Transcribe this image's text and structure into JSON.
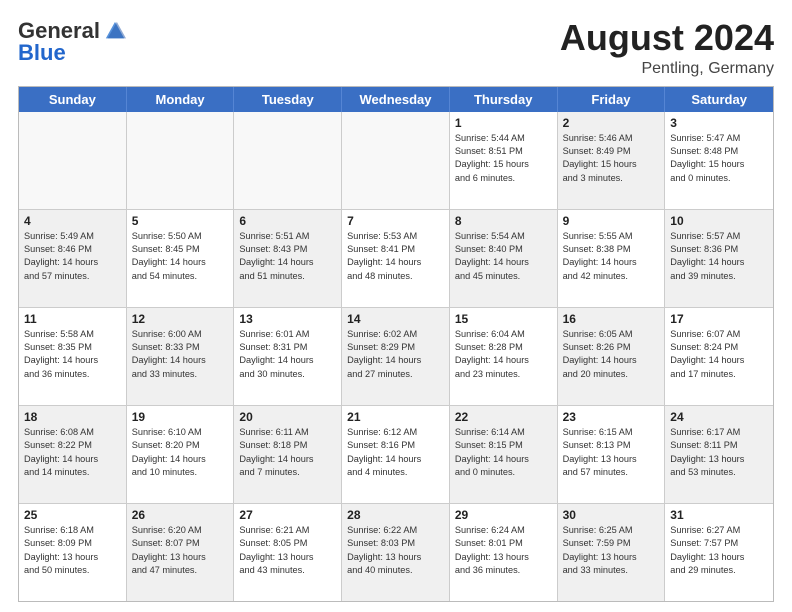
{
  "header": {
    "logo_general": "General",
    "logo_blue": "Blue",
    "month_title": "August 2024",
    "location": "Pentling, Germany"
  },
  "days_of_week": [
    "Sunday",
    "Monday",
    "Tuesday",
    "Wednesday",
    "Thursday",
    "Friday",
    "Saturday"
  ],
  "rows": [
    [
      {
        "day": "",
        "text": "",
        "empty": true
      },
      {
        "day": "",
        "text": "",
        "empty": true
      },
      {
        "day": "",
        "text": "",
        "empty": true
      },
      {
        "day": "",
        "text": "",
        "empty": true
      },
      {
        "day": "1",
        "text": "Sunrise: 5:44 AM\nSunset: 8:51 PM\nDaylight: 15 hours\nand 6 minutes."
      },
      {
        "day": "2",
        "text": "Sunrise: 5:46 AM\nSunset: 8:49 PM\nDaylight: 15 hours\nand 3 minutes.",
        "shaded": true
      },
      {
        "day": "3",
        "text": "Sunrise: 5:47 AM\nSunset: 8:48 PM\nDaylight: 15 hours\nand 0 minutes."
      }
    ],
    [
      {
        "day": "4",
        "text": "Sunrise: 5:49 AM\nSunset: 8:46 PM\nDaylight: 14 hours\nand 57 minutes.",
        "shaded": true
      },
      {
        "day": "5",
        "text": "Sunrise: 5:50 AM\nSunset: 8:45 PM\nDaylight: 14 hours\nand 54 minutes."
      },
      {
        "day": "6",
        "text": "Sunrise: 5:51 AM\nSunset: 8:43 PM\nDaylight: 14 hours\nand 51 minutes.",
        "shaded": true
      },
      {
        "day": "7",
        "text": "Sunrise: 5:53 AM\nSunset: 8:41 PM\nDaylight: 14 hours\nand 48 minutes."
      },
      {
        "day": "8",
        "text": "Sunrise: 5:54 AM\nSunset: 8:40 PM\nDaylight: 14 hours\nand 45 minutes.",
        "shaded": true
      },
      {
        "day": "9",
        "text": "Sunrise: 5:55 AM\nSunset: 8:38 PM\nDaylight: 14 hours\nand 42 minutes."
      },
      {
        "day": "10",
        "text": "Sunrise: 5:57 AM\nSunset: 8:36 PM\nDaylight: 14 hours\nand 39 minutes.",
        "shaded": true
      }
    ],
    [
      {
        "day": "11",
        "text": "Sunrise: 5:58 AM\nSunset: 8:35 PM\nDaylight: 14 hours\nand 36 minutes."
      },
      {
        "day": "12",
        "text": "Sunrise: 6:00 AM\nSunset: 8:33 PM\nDaylight: 14 hours\nand 33 minutes.",
        "shaded": true
      },
      {
        "day": "13",
        "text": "Sunrise: 6:01 AM\nSunset: 8:31 PM\nDaylight: 14 hours\nand 30 minutes."
      },
      {
        "day": "14",
        "text": "Sunrise: 6:02 AM\nSunset: 8:29 PM\nDaylight: 14 hours\nand 27 minutes.",
        "shaded": true
      },
      {
        "day": "15",
        "text": "Sunrise: 6:04 AM\nSunset: 8:28 PM\nDaylight: 14 hours\nand 23 minutes."
      },
      {
        "day": "16",
        "text": "Sunrise: 6:05 AM\nSunset: 8:26 PM\nDaylight: 14 hours\nand 20 minutes.",
        "shaded": true
      },
      {
        "day": "17",
        "text": "Sunrise: 6:07 AM\nSunset: 8:24 PM\nDaylight: 14 hours\nand 17 minutes."
      }
    ],
    [
      {
        "day": "18",
        "text": "Sunrise: 6:08 AM\nSunset: 8:22 PM\nDaylight: 14 hours\nand 14 minutes.",
        "shaded": true
      },
      {
        "day": "19",
        "text": "Sunrise: 6:10 AM\nSunset: 8:20 PM\nDaylight: 14 hours\nand 10 minutes."
      },
      {
        "day": "20",
        "text": "Sunrise: 6:11 AM\nSunset: 8:18 PM\nDaylight: 14 hours\nand 7 minutes.",
        "shaded": true
      },
      {
        "day": "21",
        "text": "Sunrise: 6:12 AM\nSunset: 8:16 PM\nDaylight: 14 hours\nand 4 minutes."
      },
      {
        "day": "22",
        "text": "Sunrise: 6:14 AM\nSunset: 8:15 PM\nDaylight: 14 hours\nand 0 minutes.",
        "shaded": true
      },
      {
        "day": "23",
        "text": "Sunrise: 6:15 AM\nSunset: 8:13 PM\nDaylight: 13 hours\nand 57 minutes."
      },
      {
        "day": "24",
        "text": "Sunrise: 6:17 AM\nSunset: 8:11 PM\nDaylight: 13 hours\nand 53 minutes.",
        "shaded": true
      }
    ],
    [
      {
        "day": "25",
        "text": "Sunrise: 6:18 AM\nSunset: 8:09 PM\nDaylight: 13 hours\nand 50 minutes."
      },
      {
        "day": "26",
        "text": "Sunrise: 6:20 AM\nSunset: 8:07 PM\nDaylight: 13 hours\nand 47 minutes.",
        "shaded": true
      },
      {
        "day": "27",
        "text": "Sunrise: 6:21 AM\nSunset: 8:05 PM\nDaylight: 13 hours\nand 43 minutes."
      },
      {
        "day": "28",
        "text": "Sunrise: 6:22 AM\nSunset: 8:03 PM\nDaylight: 13 hours\nand 40 minutes.",
        "shaded": true
      },
      {
        "day": "29",
        "text": "Sunrise: 6:24 AM\nSunset: 8:01 PM\nDaylight: 13 hours\nand 36 minutes."
      },
      {
        "day": "30",
        "text": "Sunrise: 6:25 AM\nSunset: 7:59 PM\nDaylight: 13 hours\nand 33 minutes.",
        "shaded": true
      },
      {
        "day": "31",
        "text": "Sunrise: 6:27 AM\nSunset: 7:57 PM\nDaylight: 13 hours\nand 29 minutes."
      }
    ]
  ]
}
